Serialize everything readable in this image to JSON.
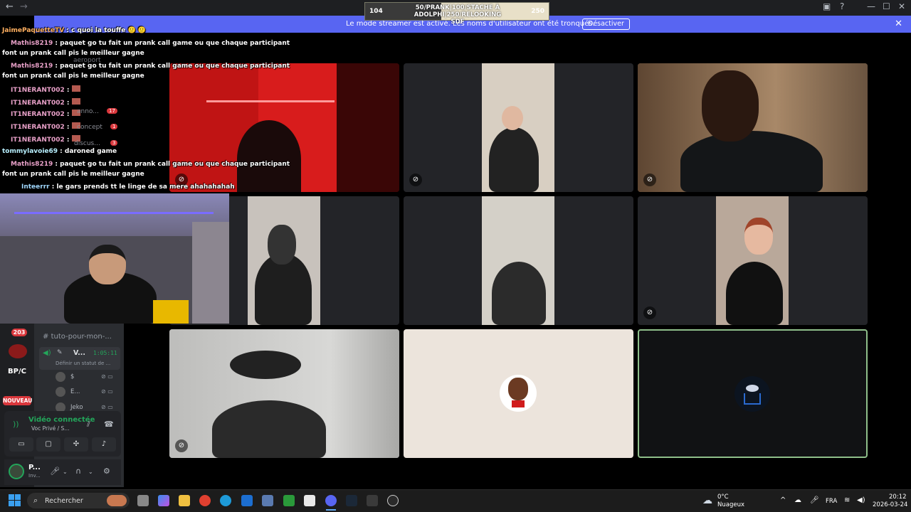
{
  "window": {
    "back_icon": "arrow-left-icon",
    "forward_icon": "arrow-right-icon"
  },
  "stream_goal": {
    "left_value": "104",
    "right_value": "250",
    "progress": 0.416,
    "text": "50/PRANK|100/STACHE À ADOLPHI|250/RELOOKING SDF"
  },
  "banner": {
    "message": "Le mode streamer est activé. Les noms d'utilisateur ont été tronqués.",
    "button": "Désactiver",
    "close_icon": "close-icon"
  },
  "chat": {
    "messages": [
      {
        "user": "JaimePaquetteTV",
        "text": "c quoi la touffe 🙂 🙂"
      },
      {
        "user": "Mathis8219",
        "text": "paquet go tu fait un prank call game ou que chaque participant",
        "cont": "font un prank call pis le meilleur gagne"
      },
      {
        "user": "Mathis8219",
        "text": "paquet go tu fait un prank call game ou que chaque participant",
        "cont": "font un prank call pis le meilleur gagne"
      },
      {
        "user": "IT1NERANT002",
        "text": ""
      },
      {
        "user": "IT1NERANT002",
        "text": ""
      },
      {
        "user": "IT1NERANT002",
        "text": ""
      },
      {
        "user": "IT1NERANT002",
        "text": ""
      },
      {
        "user": "IT1NERANT002",
        "text": ""
      },
      {
        "user": "tommylavoie69",
        "text": "daroned game"
      },
      {
        "user": "Mathis8219",
        "text": "paquet go tu fait un prank call game ou que chaque participant",
        "cont": "font un prank call pis le meilleur gagne"
      },
      {
        "user": "Inteerrr",
        "text": "le gars prends tt le linge de sa mere ahahahahah"
      }
    ],
    "underlay_channels": [
      {
        "name": "aeroport"
      },
      {
        "name": "anno...",
        "badge": "17"
      },
      {
        "name": "concept",
        "badge": "1"
      },
      {
        "name": "discus...",
        "badge": "3"
      }
    ]
  },
  "servers": {
    "badge_203": "203",
    "bpc": "BP/C",
    "nouveau": "NOUVEAU"
  },
  "channel": {
    "text_channel": "tuto-pour-mon-...",
    "voice_user": "V...",
    "voice_time": "1:05:11",
    "voice_status": "Définir un statut de ...",
    "members": [
      {
        "name": "$"
      },
      {
        "name": "E..."
      },
      {
        "name": "Jeko"
      }
    ]
  },
  "voice_panel": {
    "title": "Vidéo connectée",
    "subtitle": "Voc Privé / S..."
  },
  "user_panel": {
    "name": "P...",
    "status": "Inv..."
  },
  "tiles": [
    {
      "name": "participant-1",
      "muted": true
    },
    {
      "name": "participant-2",
      "muted": true
    },
    {
      "name": "participant-3",
      "muted": true
    },
    {
      "name": "participant-4",
      "muted": false
    },
    {
      "name": "participant-5",
      "muted": false
    },
    {
      "name": "participant-6",
      "muted": true
    },
    {
      "name": "participant-7",
      "muted": true
    },
    {
      "name": "participant-8-avatar",
      "muted": false
    },
    {
      "name": "participant-9-avatar",
      "muted": false
    }
  ],
  "taskbar": {
    "search_placeholder": "Rechercher",
    "weather_temp": "0°C",
    "weather_desc": "Nuageux",
    "language": "FRA",
    "time": "20:12",
    "date": "2026-03-24"
  },
  "colors": {
    "discord_blurple": "#5865f2",
    "voice_green": "#23a55a",
    "active_tile_border": "#8fbf8a"
  }
}
